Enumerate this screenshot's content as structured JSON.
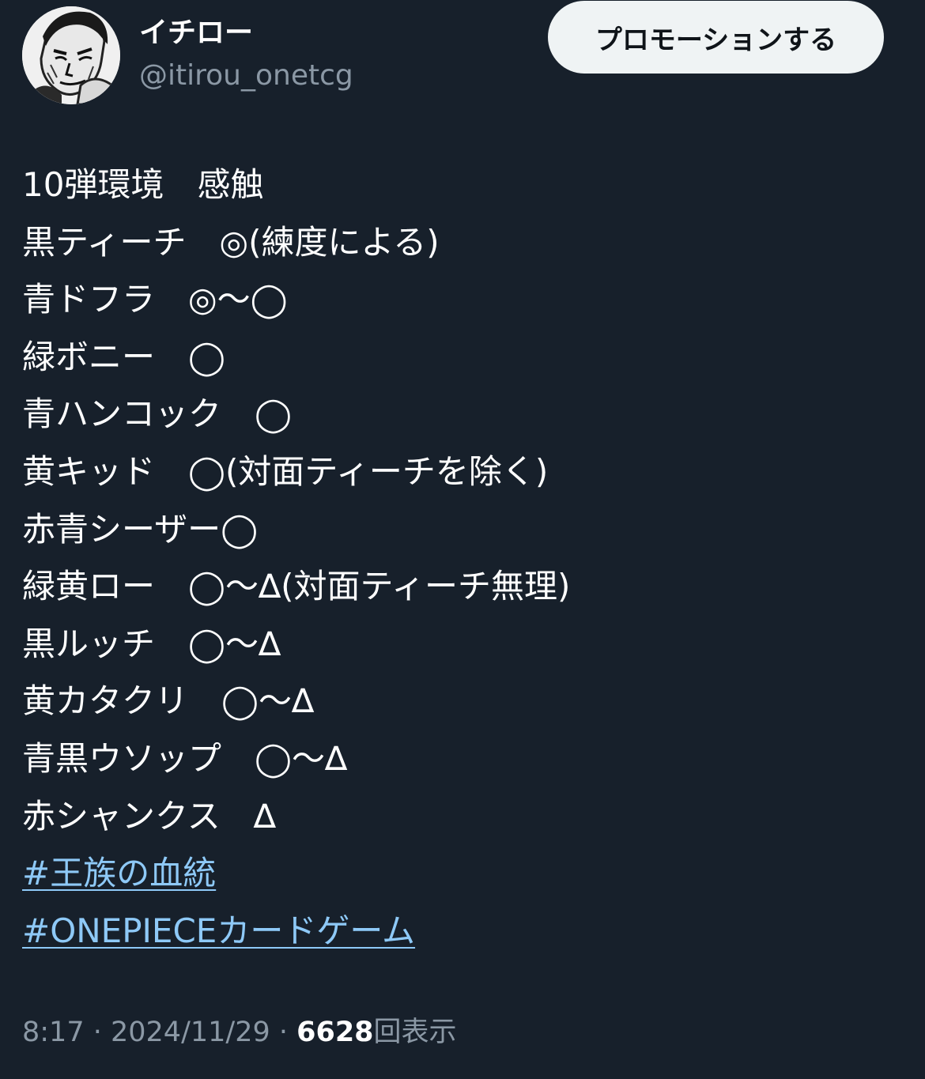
{
  "author": {
    "display_name": "イチロー",
    "handle": "@itirou_onetcg",
    "avatar_icon": "manga-face-avatar"
  },
  "promote_button": {
    "label": "プロモーションする"
  },
  "tweet": {
    "lines": [
      "10弾環境　感触",
      "黒ティーチ　◎(練度による)",
      "青ドフラ　◎〜◯",
      "緑ボニー　◯",
      "青ハンコック　◯",
      "黄キッド　◯(対面ティーチを除く)",
      "赤青シーザー◯",
      "緑黄ロー　◯〜∆(対面ティーチ無理)",
      "黒ルッチ　◯〜∆",
      "黄カタクリ　◯〜∆",
      "青黒ウソップ　◯〜∆",
      "赤シャンクス　∆"
    ],
    "hashtags": [
      "#王族の血統",
      "#ONEPIECEカードゲーム"
    ]
  },
  "meta": {
    "time": "8:17",
    "separator": " · ",
    "date": "2024/11/29",
    "views_count": "6628",
    "views_label": "回表示"
  },
  "colors": {
    "background": "#17202b",
    "text": "#ffffff",
    "secondary_text": "#8b98a5",
    "link": "#8ec9f7",
    "button_bg": "#eff3f4"
  }
}
